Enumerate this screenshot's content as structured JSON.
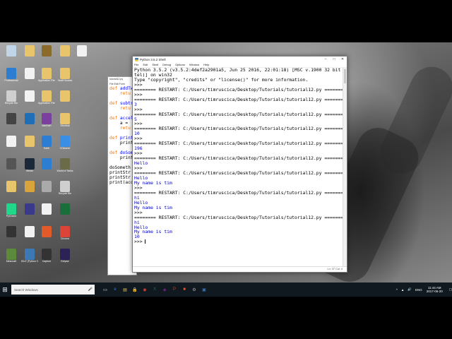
{
  "shell": {
    "title": "Python 3.5.2 Shell",
    "menu": [
      "File",
      "Edit",
      "Shell",
      "Debug",
      "Options",
      "Window",
      "Help"
    ],
    "status": "Ln: 37  Col: 4",
    "lines": [
      {
        "t": "Python 3.5.2 (v3.5.2:4def2a2901a5, Jun 25 2016, 22:01:18) [MSC v.1900 32 bit (In",
        "c": "restart"
      },
      {
        "t": "tel)] on win32",
        "c": "restart"
      },
      {
        "t": "Type \"copyright\", \"credits\" or \"license()\" for more information.",
        "c": "restart"
      },
      {
        "t": ">>> ",
        "c": "restart"
      },
      {
        "t": "======== RESTART: C:/Users/timruscica/Desktop/Tutorials/tutorial12.py ========",
        "c": "restart"
      },
      {
        "t": ">>> ",
        "c": "restart"
      },
      {
        "t": "======== RESTART: C:/Users/timruscica/Desktop/Tutorials/tutorial12.py ========",
        "c": "restart"
      },
      {
        "t": "3",
        "c": "out"
      },
      {
        "t": ">>> ",
        "c": "restart"
      },
      {
        "t": "======== RESTART: C:/Users/timruscica/Desktop/Tutorials/tutorial12.py ========",
        "c": "restart"
      },
      {
        "t": "5",
        "c": "out"
      },
      {
        "t": ">>> ",
        "c": "restart"
      },
      {
        "t": "======== RESTART: C:/Users/timruscica/Desktop/Tutorials/tutorial12.py ========",
        "c": "restart"
      },
      {
        "t": "10",
        "c": "out"
      },
      {
        "t": ">>> ",
        "c": "restart"
      },
      {
        "t": "======== RESTART: C:/Users/timruscica/Desktop/Tutorials/tutorial12.py ========",
        "c": "restart"
      },
      {
        "t": "196",
        "c": "out"
      },
      {
        "t": ">>> ",
        "c": "restart"
      },
      {
        "t": "======== RESTART: C:/Users/timruscica/Desktop/Tutorials/tutorial12.py ========",
        "c": "restart"
      },
      {
        "t": "Hello",
        "c": "out"
      },
      {
        "t": ">>> ",
        "c": "restart"
      },
      {
        "t": "======== RESTART: C:/Users/timruscica/Desktop/Tutorials/tutorial12.py ========",
        "c": "restart"
      },
      {
        "t": "Hello",
        "c": "out"
      },
      {
        "t": "My name is tim",
        "c": "out"
      },
      {
        "t": ">>> ",
        "c": "restart"
      },
      {
        "t": "======== RESTART: C:/Users/timruscica/Desktop/Tutorials/tutorial12.py ========",
        "c": "restart"
      },
      {
        "t": "hi",
        "c": "out"
      },
      {
        "t": "Hello",
        "c": "out"
      },
      {
        "t": "My name is tim",
        "c": "out"
      },
      {
        "t": ">>> ",
        "c": "restart"
      },
      {
        "t": "======== RESTART: C:/Users/timruscica/Desktop/Tutorials/tutorial12.py ========",
        "c": "restart"
      },
      {
        "t": "hi",
        "c": "out"
      },
      {
        "t": "Hello",
        "c": "out"
      },
      {
        "t": "My name is tim",
        "c": "out"
      },
      {
        "t": "10",
        "c": "out"
      },
      {
        "t": ">>> ",
        "c": "restart"
      }
    ]
  },
  "editor": {
    "title": "tutorial12.py",
    "menu": "File  Edit  Form",
    "lines": [
      {
        "k": "def ",
        "r": "addTw"
      },
      {
        "k": "    retu",
        "r": ""
      },
      {
        "k": "",
        "r": ""
      },
      {
        "k": "def ",
        "r": "subtr"
      },
      {
        "k": "    retu",
        "r": ""
      },
      {
        "k": "",
        "r": ""
      },
      {
        "k": "def ",
        "r": "accel"
      },
      {
        "k": "",
        "r": "    a = "
      },
      {
        "k": "    retu",
        "r": ""
      },
      {
        "k": "",
        "r": ""
      },
      {
        "k": "def ",
        "r": "print"
      },
      {
        "k": "",
        "r": "    print"
      },
      {
        "k": "",
        "r": ""
      },
      {
        "k": "def ",
        "r": "doSom"
      },
      {
        "k": "",
        "r": "    print"
      },
      {
        "k": "",
        "r": ""
      },
      {
        "k": "",
        "r": "doSometh"
      },
      {
        "k": "",
        "r": "printStr"
      },
      {
        "k": "",
        "r": "printStr"
      },
      {
        "k": "",
        "r": "print(acc"
      }
    ]
  },
  "desktop_icons": [
    {
      "label": "",
      "color": "#c0d6e8"
    },
    {
      "label": "",
      "color": "#e8c56a"
    },
    {
      "label": "",
      "color": "#8a6b2a"
    },
    {
      "label": "",
      "color": "#e8c56a"
    },
    {
      "label": "",
      "color": "#f2f2f2"
    },
    {
      "label": "Professional",
      "color": "#2d7dd2"
    },
    {
      "label": "",
      "color": "#f2f2f2"
    },
    {
      "label": "Application Files",
      "color": "#e8c56a"
    },
    {
      "label": "Vault Houses",
      "color": "#e8c56a"
    },
    {
      "label": "Recycle Bin",
      "color": "#cfcfcf"
    },
    {
      "label": "",
      "color": "#f2f2f2"
    },
    {
      "label": "Application Files",
      "color": "#e8c56a"
    },
    {
      "label": "",
      "color": "#e8c56a"
    },
    {
      "label": "",
      "color": "#444"
    },
    {
      "label": "",
      "color": "#1e6fb8"
    },
    {
      "label": "WinRAR",
      "color": "#7b3f9e"
    },
    {
      "label": "Shortcut",
      "color": "#e8c56a"
    },
    {
      "label": "",
      "color": "#f2f2f2"
    },
    {
      "label": "",
      "color": "#e8c56a"
    },
    {
      "label": "Earth",
      "color": "#2d7dd2"
    },
    {
      "label": "CCleaner",
      "color": "#3a8ee6"
    },
    {
      "label": "",
      "color": "#555"
    },
    {
      "label": "Steam",
      "color": "#1b2838"
    },
    {
      "label": "",
      "color": "#2d7dd2"
    },
    {
      "label": "World of Tanks",
      "color": "#6b6b4a"
    },
    {
      "label": "",
      "color": "#e8c56a"
    },
    {
      "label": "",
      "color": "#d9a43a"
    },
    {
      "label": "",
      "color": "#aaa"
    },
    {
      "label": "Recycle Bin",
      "color": "#cfcfcf"
    },
    {
      "label": "PyCharm",
      "color": "#21d789"
    },
    {
      "label": "",
      "color": "#3a3a8a"
    },
    {
      "label": "",
      "color": "#f2f2f2"
    },
    {
      "label": "",
      "color": "#1a6e3a"
    },
    {
      "label": "",
      "color": "#333"
    },
    {
      "label": "",
      "color": "#f2f2f2"
    },
    {
      "label": "",
      "color": "#e05a2a"
    },
    {
      "label": "Chrome",
      "color": "#db4437"
    },
    {
      "label": "Minecraft",
      "color": "#5a8a3a"
    },
    {
      "label": "IDLE (Python 3.5 32-bit)",
      "color": "#3c78b4"
    },
    {
      "label": "Capture",
      "color": "#333"
    },
    {
      "label": "Eclipse",
      "color": "#2c2255"
    }
  ],
  "taskbar": {
    "search_placeholder": "Search Windows",
    "apps": [
      "▭",
      "e",
      "▤",
      "🔒",
      "◉",
      "X",
      "◆",
      "P",
      "■",
      "⚙",
      "▣"
    ],
    "tray": [
      "^",
      "▲",
      "🔊",
      "ENG"
    ],
    "time": "11:44 AM",
    "date": "2017-06-20"
  },
  "colors": {
    "keyword": "#ff7700",
    "output": "#0000c0",
    "taskbar": "#101820"
  }
}
